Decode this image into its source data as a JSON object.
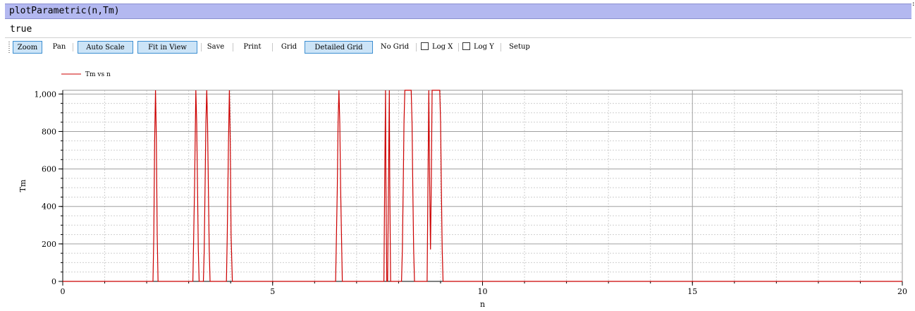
{
  "command": {
    "text": "plotParametric(n,Tm)",
    "corner_mark": ":"
  },
  "result": {
    "text": "true"
  },
  "toolbar": {
    "buttons": [
      {
        "label": "Zoom",
        "active": true
      },
      {
        "label": "Pan",
        "active": false
      },
      {
        "label": "Auto Scale",
        "active": true
      },
      {
        "label": "Fit in View",
        "active": true
      },
      {
        "label": "Save",
        "active": false
      },
      {
        "label": "Print",
        "active": false
      },
      {
        "label": "Grid",
        "active": false
      },
      {
        "label": "Detailed Grid",
        "active": true
      },
      {
        "label": "No Grid",
        "active": false
      }
    ],
    "checkboxes": [
      {
        "label": "Log X",
        "checked": false
      },
      {
        "label": "Log Y",
        "checked": false
      }
    ],
    "setup_label": "Setup"
  },
  "colors": {
    "series": "#cc0000",
    "command_bar": "#b3b8f0",
    "active_button": "#cce4f7",
    "active_border": "#3d8fd1",
    "major_grid": "#a0a0a0",
    "minor_grid": "#cfcfcf"
  },
  "chart_data": {
    "type": "line",
    "title": "",
    "xlabel": "n",
    "ylabel": "Tm",
    "xlim": [
      0,
      20
    ],
    "ylim": [
      0,
      1020
    ],
    "grid": "detailed",
    "legend_position": "top-left",
    "x_ticks": [
      0,
      5,
      10,
      15,
      20
    ],
    "x_tick_labels": [
      "0",
      "5",
      "10",
      "15",
      "20"
    ],
    "y_ticks": [
      0,
      200,
      400,
      600,
      800,
      1000
    ],
    "y_tick_labels": [
      "0",
      "200",
      "400",
      "600",
      "800",
      "1,000"
    ],
    "series": [
      {
        "name": "Tm vs n",
        "points": [
          [
            0,
            0
          ],
          [
            2.15,
            0
          ],
          [
            2.17,
            250
          ],
          [
            2.19,
            760
          ],
          [
            2.21,
            1020
          ],
          [
            2.23,
            760
          ],
          [
            2.25,
            250
          ],
          [
            2.27,
            0
          ],
          [
            3.1,
            0
          ],
          [
            3.12,
            250
          ],
          [
            3.14,
            500
          ],
          [
            3.16,
            850
          ],
          [
            3.17,
            1020
          ],
          [
            3.19,
            850
          ],
          [
            3.21,
            500
          ],
          [
            3.23,
            170
          ],
          [
            3.25,
            0
          ],
          [
            3.35,
            0
          ],
          [
            3.37,
            170
          ],
          [
            3.39,
            500
          ],
          [
            3.41,
            850
          ],
          [
            3.43,
            1020
          ],
          [
            3.45,
            850
          ],
          [
            3.47,
            500
          ],
          [
            3.49,
            170
          ],
          [
            3.51,
            0
          ],
          [
            3.9,
            0
          ],
          [
            3.92,
            250
          ],
          [
            3.95,
            760
          ],
          [
            3.97,
            1020
          ],
          [
            3.99,
            760
          ],
          [
            4.01,
            250
          ],
          [
            4.04,
            0
          ],
          [
            6.5,
            0
          ],
          [
            6.52,
            250
          ],
          [
            6.54,
            500
          ],
          [
            6.56,
            850
          ],
          [
            6.58,
            1020
          ],
          [
            6.6,
            850
          ],
          [
            6.62,
            500
          ],
          [
            6.64,
            250
          ],
          [
            6.66,
            0
          ],
          [
            7.65,
            0
          ],
          [
            7.67,
            520
          ],
          [
            7.69,
            1020
          ],
          [
            7.7,
            520
          ],
          [
            7.72,
            0
          ],
          [
            7.74,
            0
          ],
          [
            7.76,
            520
          ],
          [
            7.78,
            1020
          ],
          [
            7.79,
            520
          ],
          [
            7.81,
            0
          ],
          [
            8.07,
            0
          ],
          [
            8.09,
            170
          ],
          [
            8.11,
            500
          ],
          [
            8.13,
            850
          ],
          [
            8.15,
            1020
          ],
          [
            8.3,
            1020
          ],
          [
            8.32,
            850
          ],
          [
            8.34,
            500
          ],
          [
            8.36,
            170
          ],
          [
            8.38,
            0
          ],
          [
            8.68,
            0
          ],
          [
            8.7,
            520
          ],
          [
            8.72,
            1020
          ],
          [
            8.74,
            520
          ],
          [
            8.76,
            170
          ],
          [
            8.78,
            520
          ],
          [
            8.8,
            1020
          ],
          [
            8.98,
            1020
          ],
          [
            9.0,
            850
          ],
          [
            9.02,
            500
          ],
          [
            9.04,
            170
          ],
          [
            9.06,
            0
          ],
          [
            20,
            0
          ]
        ]
      }
    ]
  }
}
